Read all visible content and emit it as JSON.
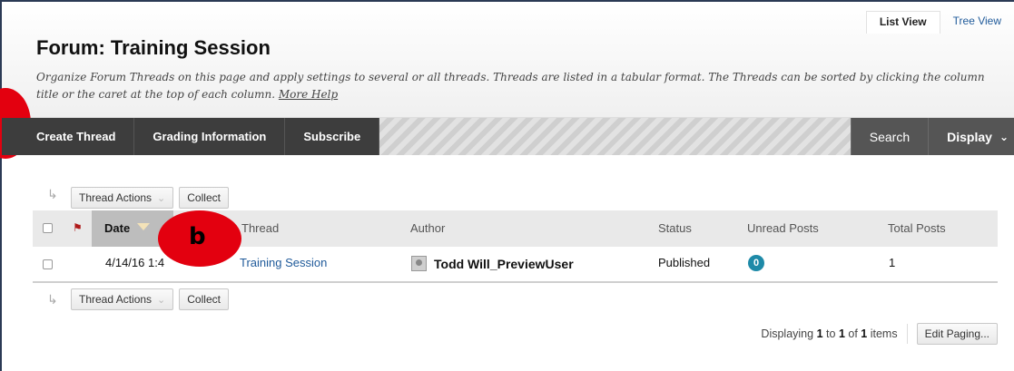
{
  "view_tabs": {
    "list": "List View",
    "tree": "Tree View"
  },
  "header": {
    "title": "Forum: Training Session",
    "description": "Organize Forum Threads on this page and apply settings to several or all threads. Threads are listed in a tabular format. The Threads can be sorted by clicking the column title or the caret at the top of each column.",
    "help_link": "More Help"
  },
  "action_bar": {
    "create": "Create Thread",
    "grading": "Grading Information",
    "subscribe": "Subscribe",
    "search": "Search",
    "display": "Display"
  },
  "thread_actions": {
    "actions": "Thread Actions",
    "collect": "Collect"
  },
  "table": {
    "columns": {
      "date": "Date",
      "thread": "Thread",
      "author": "Author",
      "status": "Status",
      "unread": "Unread Posts",
      "total": "Total Posts"
    },
    "rows": [
      {
        "date": "4/14/16 1:4",
        "thread": "Training Session",
        "author": "Todd Will_PreviewUser",
        "status": "Published",
        "unread": "0",
        "total": "1"
      }
    ]
  },
  "paging": {
    "prefix": "Displaying",
    "from": "1",
    "to_word": "to",
    "to": "1",
    "of_word": "of",
    "total": "1",
    "suffix": "items",
    "edit": "Edit Paging..."
  },
  "markers": {
    "b": "b"
  },
  "colors": {
    "accent_red": "#e3000f",
    "badge": "#1e8aa8",
    "link": "#1f5a9a"
  }
}
